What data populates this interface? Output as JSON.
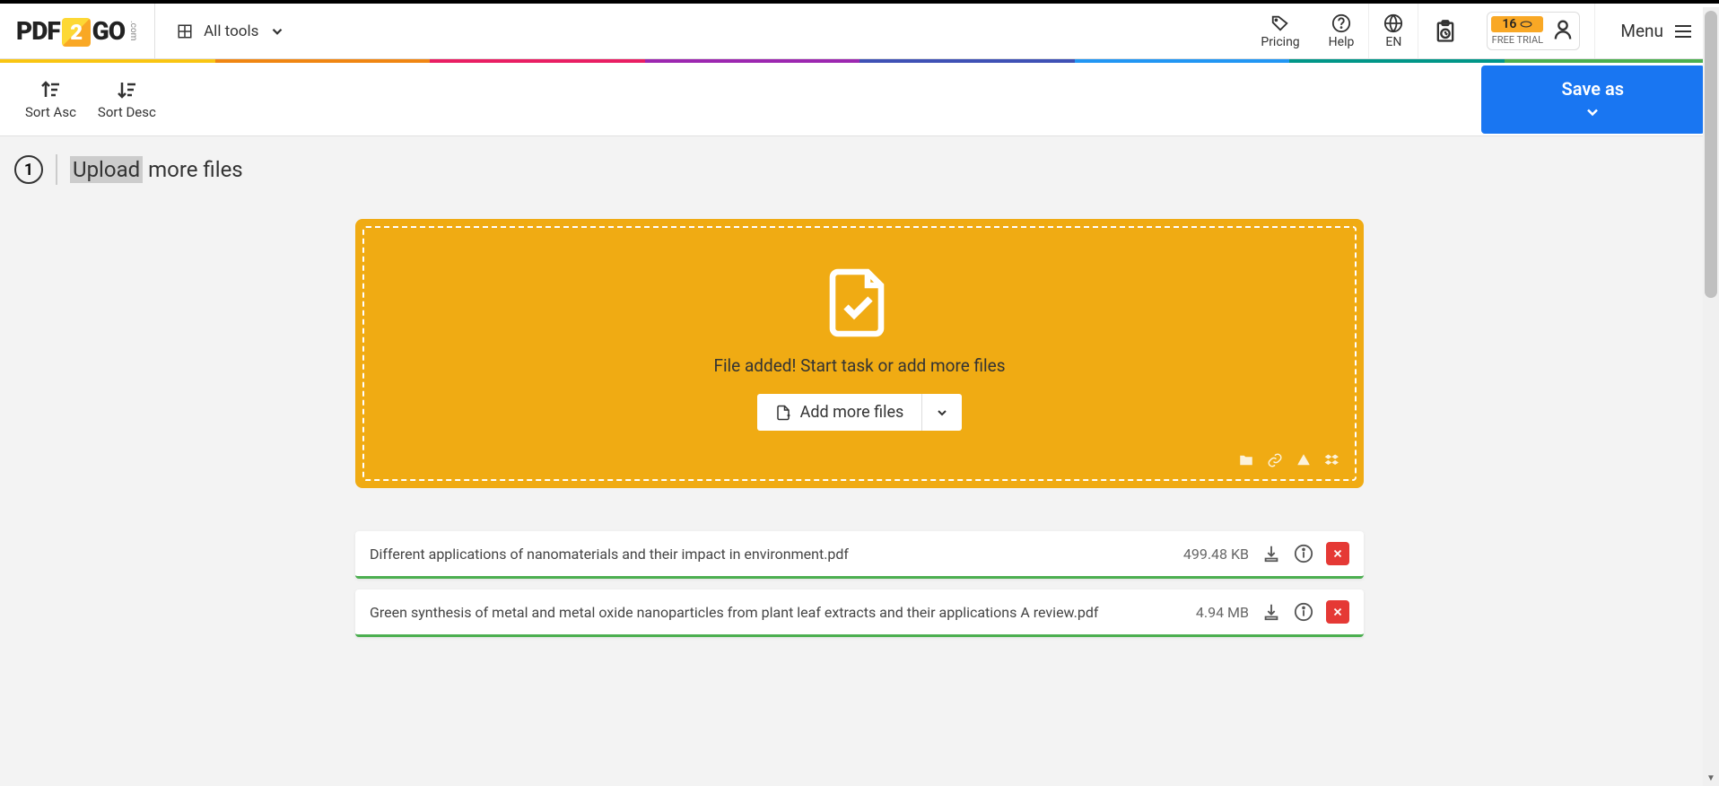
{
  "header": {
    "logo_pdf": "PDF",
    "logo_2": "2",
    "logo_go": "GO",
    "logo_com": ".com",
    "all_tools": "All tools",
    "pricing": "Pricing",
    "help": "Help",
    "language": "EN",
    "trial_count": "16",
    "trial_label": "FREE TRIAL",
    "menu": "Menu"
  },
  "toolbar": {
    "sort_asc": "Sort Asc",
    "sort_desc": "Sort Desc",
    "save_as": "Save as"
  },
  "step": {
    "number": "1",
    "title_hl": "Upload",
    "title_rest": " more files"
  },
  "dropzone": {
    "message": "File added! Start task or add more files",
    "add_more": "Add more files"
  },
  "files": [
    {
      "name": "Different applications of nanomaterials and their impact in environment.pdf",
      "size": "499.48 KB"
    },
    {
      "name": "Green synthesis of metal and metal oxide nanoparticles from plant leaf extracts and their applications A review.pdf",
      "size": "4.94 MB"
    }
  ]
}
